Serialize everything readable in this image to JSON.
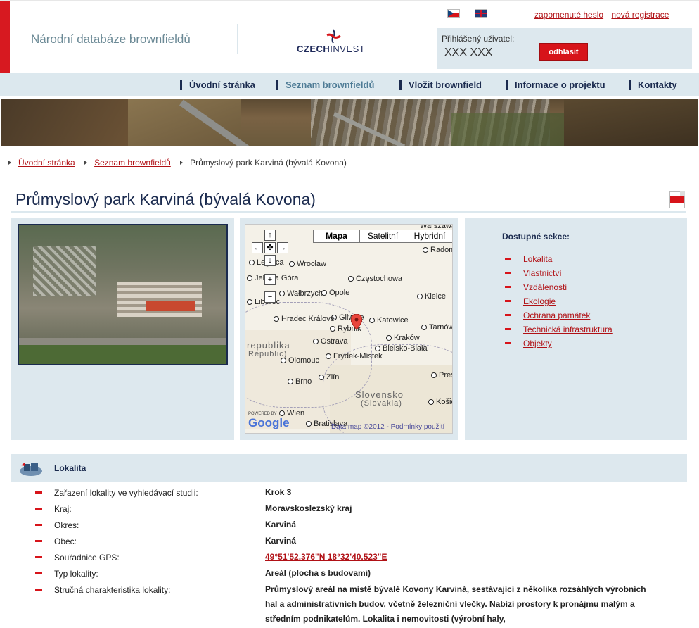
{
  "header": {
    "site_title": "Národní databáze brownfieldů",
    "logo_text_bold": "CZECH",
    "logo_text": "INVEST",
    "top_links": [
      "zapomenuté heslo",
      "nová registrace"
    ],
    "login_label": "Přihlášený uživatel:",
    "login_user": "XXX XXX",
    "logout_label": "odhlásit"
  },
  "nav": {
    "items": [
      "Úvodní stránka",
      "Seznam brownfieldů",
      "Vložit brownfield",
      "Informace o projektu",
      "Kontakty"
    ],
    "active_index": 1
  },
  "breadcrumb": {
    "items": [
      "Úvodní stránka",
      "Seznam brownfieldů"
    ],
    "current": "Průmyslový park Karviná (bývalá Kovona)"
  },
  "page_title": "Průmyslový park Karviná (bývalá Kovona)",
  "map": {
    "types": [
      "Mapa",
      "Satelitní",
      "Hybridní"
    ],
    "active_type": "Mapa",
    "cities": [
      "Legnica",
      "Wrocław",
      "Częstochowa",
      "Radom",
      "Jelenia Góra",
      "Wałbrzych",
      "Opole",
      "Kielce",
      "Liberec",
      "Gliwice",
      "Katowice",
      "Hradec Králové",
      "Rybnik",
      "Tarnów",
      "Ostrava",
      "Kraków",
      "Frýdek-Místek",
      "Bielsko-Biała",
      "Olomouc",
      "Brno",
      "Zlín",
      "Prešov",
      "Košice",
      "Wien",
      "Bratislava"
    ],
    "countries": [
      "republika",
      "Republic)",
      "Slovensko",
      "(Slovakia)"
    ],
    "city_nodot": "Warszawa",
    "google": "Google",
    "powered_by": "POWERED BY",
    "terms": "Data map ©2012 - Podmínky použití"
  },
  "sections": {
    "title": "Dostupné sekce:",
    "items": [
      "Lokalita",
      "Vlastnictví",
      "Vzdálenosti",
      "Ekologie",
      "Ochrana památek",
      "Technická infrastruktura",
      "Objekty"
    ]
  },
  "lokalita": {
    "title": "Lokalita",
    "rows": [
      {
        "label": "Zařazení lokality ve vyhledávací studii:",
        "value": "Krok 3"
      },
      {
        "label": "Kraj:",
        "value": "Moravskoslezský kraj"
      },
      {
        "label": "Okres:",
        "value": "Karviná"
      },
      {
        "label": "Obec:",
        "value": "Karviná"
      },
      {
        "label": "Souřadnice GPS:",
        "value": "49°51'52.376\"N 18°32'40.523\"E"
      },
      {
        "label": "Typ lokality:",
        "value": "Areál (plocha s budovami)"
      },
      {
        "label": "Stručná charakteristika lokality:",
        "value": "Průmyslový areál na místě bývalé Kovony Karviná, sestávající z několika rozsáhlých výrobních hal a administrativních budov, včetně železniční vlečky. Nabízí prostory k pronájmu malým a středním podnikatelům. Lokalita i nemovitosti (výrobní haly,"
      }
    ]
  },
  "colors": {
    "accent_red": "#d71920",
    "nav_bg": "#dce8ee",
    "dark_blue": "#1b2b4f",
    "link_red": "#b11116"
  }
}
